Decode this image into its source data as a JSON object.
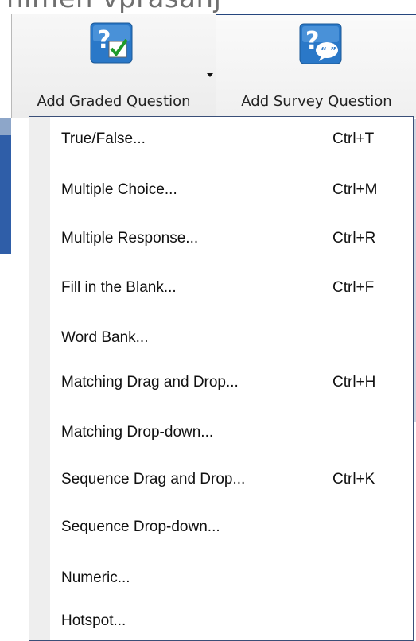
{
  "top_text": "nimen vprasanj",
  "ribbon": {
    "graded": {
      "label": "Add Graded Question",
      "icon": "question-check-icon"
    },
    "survey": {
      "label": "Add Survey Question",
      "icon": "question-speech-bubble-icon"
    }
  },
  "menu": {
    "items": [
      {
        "label": "True/False...",
        "shortcut": "Ctrl+T"
      },
      {
        "label": "Multiple Choice...",
        "shortcut": "Ctrl+M"
      },
      {
        "label": "Multiple Response...",
        "shortcut": "Ctrl+R"
      },
      {
        "label": "Fill in the Blank...",
        "shortcut": "Ctrl+F"
      },
      {
        "label": "Word Bank...",
        "shortcut": ""
      },
      {
        "label": "Matching Drag and Drop...",
        "shortcut": "Ctrl+H"
      },
      {
        "label": "Matching Drop-down...",
        "shortcut": ""
      },
      {
        "label": "Sequence Drag and Drop...",
        "shortcut": "Ctrl+K"
      },
      {
        "label": "Sequence Drop-down...",
        "shortcut": ""
      },
      {
        "label": "Numeric...",
        "shortcut": ""
      },
      {
        "label": "Hotspot...",
        "shortcut": ""
      }
    ]
  },
  "colors": {
    "accent_blue": "#2f5ea8",
    "menu_border": "#3a4f78",
    "icon_blue": "#2a78c8",
    "check_green": "#1f9a2a"
  }
}
